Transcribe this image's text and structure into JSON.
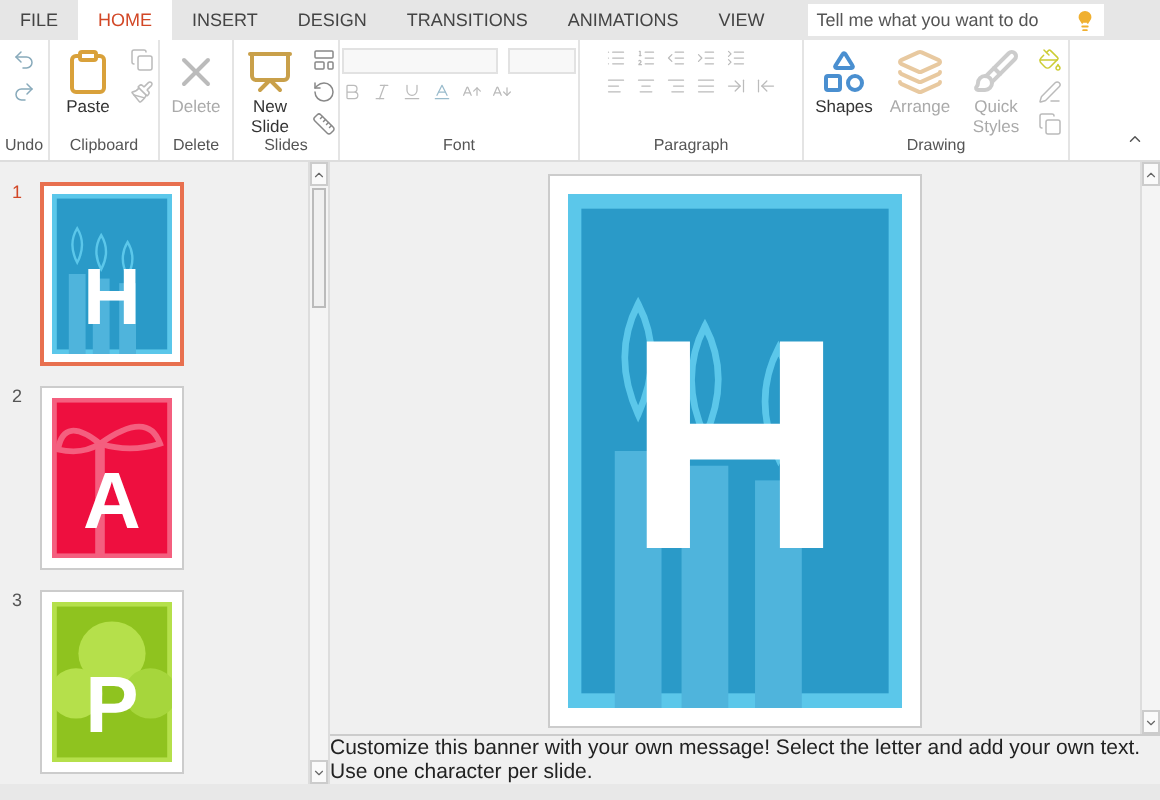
{
  "tabs": [
    {
      "label": "FILE",
      "selected": false
    },
    {
      "label": "HOME",
      "selected": true
    },
    {
      "label": "INSERT",
      "selected": false
    },
    {
      "label": "DESIGN",
      "selected": false
    },
    {
      "label": "TRANSITIONS",
      "selected": false
    },
    {
      "label": "ANIMATIONS",
      "selected": false
    },
    {
      "label": "VIEW",
      "selected": false
    }
  ],
  "search": {
    "placeholder": "Tell me what you want to do"
  },
  "ribbon": {
    "groups": [
      {
        "label": "Undo",
        "kind": "undo"
      },
      {
        "label": "Clipboard",
        "kind": "clipboard",
        "buttons": [
          {
            "label": "Paste",
            "disabled": false
          }
        ]
      },
      {
        "label": "Delete",
        "kind": "delete",
        "buttons": [
          {
            "label": "Delete",
            "disabled": true
          }
        ]
      },
      {
        "label": "Slides",
        "kind": "slides",
        "buttons": [
          {
            "label": "New Slide",
            "disabled": false
          }
        ]
      },
      {
        "label": "Font",
        "kind": "font"
      },
      {
        "label": "Paragraph",
        "kind": "paragraph"
      },
      {
        "label": "Drawing",
        "kind": "drawing",
        "buttons": [
          {
            "label": "Shapes",
            "disabled": false
          },
          {
            "label": "Arrange",
            "disabled": true
          },
          {
            "label": "Quick Styles",
            "disabled": true
          }
        ]
      }
    ]
  },
  "slides": [
    {
      "number": "1",
      "letter": "H",
      "kind": "candles",
      "color": "#2a9ac8",
      "selected": true
    },
    {
      "number": "2",
      "letter": "A",
      "kind": "bow",
      "color": "#ee0f3f",
      "selected": false
    },
    {
      "number": "3",
      "letter": "P",
      "kind": "balloons",
      "color": "#8fc31f",
      "selected": false
    }
  ],
  "canvas": {
    "letter": "H",
    "kind": "candles",
    "color": "#2a9ac8"
  },
  "notes": "Customize this banner with your own message! Select the letter and add your own text. Use one character per slide."
}
